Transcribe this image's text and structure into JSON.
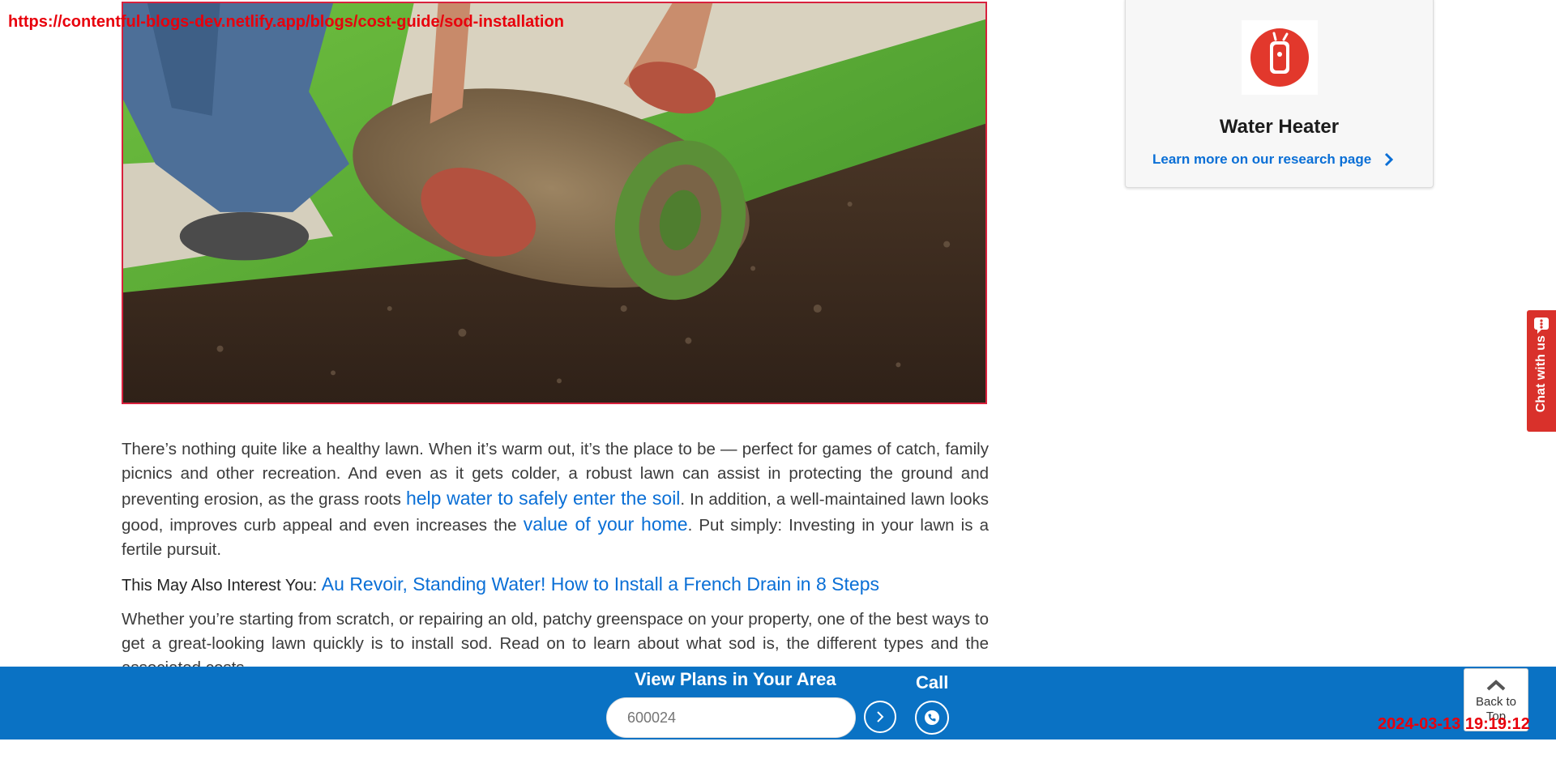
{
  "overlay": {
    "url": "https://contentful-blogs-dev.netlify.app/blogs/cost-guide/sod-installation",
    "timestamp": "2024-03-13 19:19:12"
  },
  "hero": {
    "icon": "sod-roll-photo"
  },
  "article": {
    "p1_text1": "There’s nothing quite like a healthy lawn. When it’s warm out, it’s the place to be — perfect for games of catch, family picnics and other recreation. And even as it gets colder, a robust lawn can assist in protecting the ground and preventing erosion, as the grass roots ",
    "p1_link1": "help water to safely enter the soil",
    "p1_text2": ". In addition, a well-maintained lawn looks good, improves curb appeal and even increases the ",
    "p1_link2": "value of your home",
    "p1_text3": ". Put simply: Investing in your lawn is a fertile pursuit.",
    "interest_label": "This May Also Interest You: ",
    "interest_link": "Au Revoir, Standing Water! How to Install a French Drain in 8 Steps",
    "p2": "Whether you’re starting from scratch, or repairing an old, patchy greenspace on your property, one of the best ways to get a great-looking lawn quickly is to install sod. Read on to learn about what sod is, the different types and the associated costs."
  },
  "sidebar_card": {
    "title": "Water Heater",
    "link_label": "Learn more on our research page",
    "icon": "water-heater-icon"
  },
  "chat": {
    "label": "Chat with us"
  },
  "bottom_bar": {
    "title": "View Plans in Your Area",
    "zip_placeholder": "600024",
    "call_label": "Call",
    "back_to_top": "Back to Top"
  },
  "colors": {
    "brand_blue": "#0a72c4",
    "link_blue": "#0a6fd6",
    "accent_red": "#d9312b"
  }
}
